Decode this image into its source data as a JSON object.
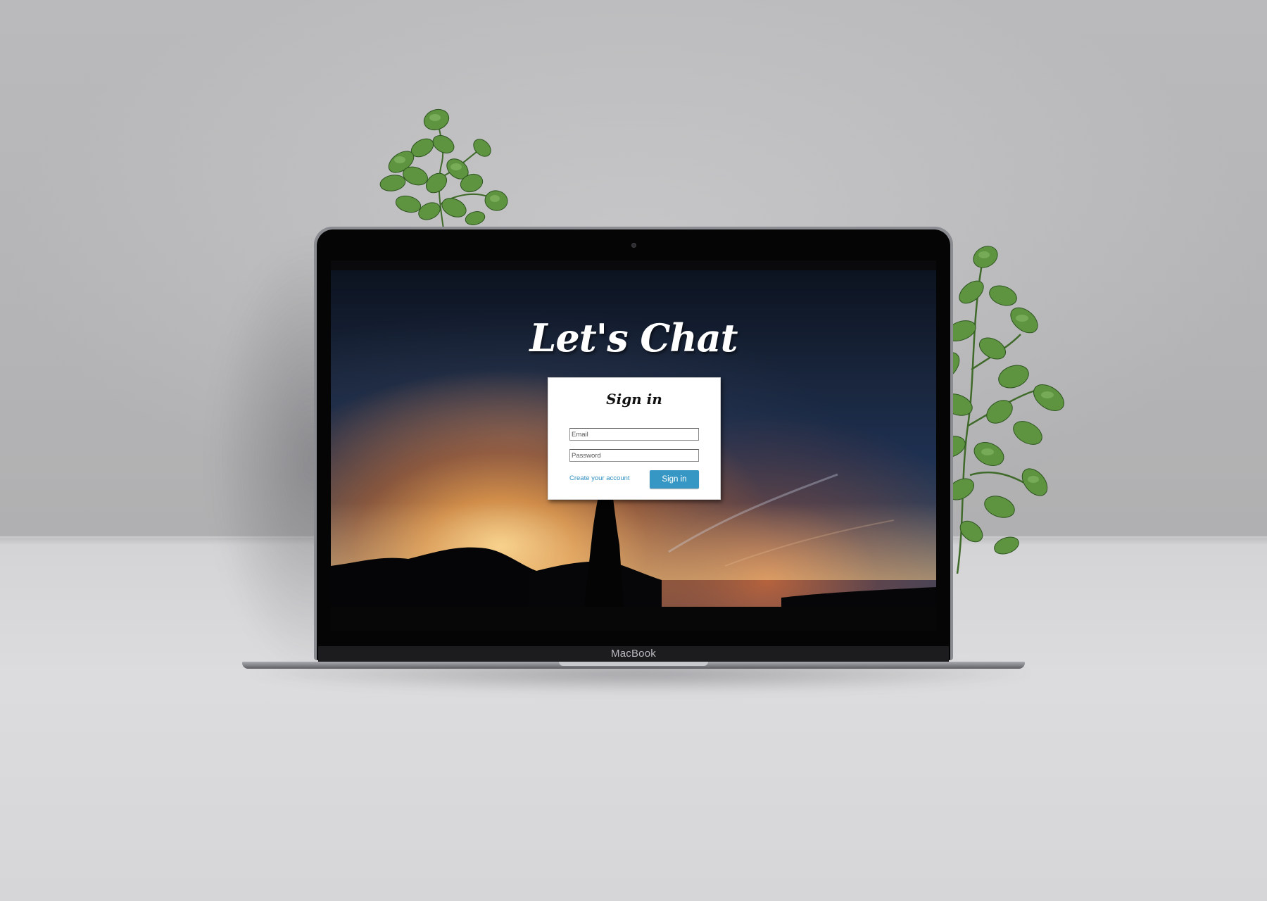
{
  "device": {
    "brand_label": "MacBook"
  },
  "app": {
    "title": "Let's Chat"
  },
  "signin_card": {
    "heading": "Sign in",
    "email_placeholder": "Email",
    "password_placeholder": "Password",
    "create_account_link": "Create your account",
    "submit_label": "Sign in"
  },
  "icons": {
    "camera": "webcam-icon",
    "plant_left": "plant-icon",
    "plant_right": "plant-icon"
  },
  "colors": {
    "accent": "#3697c5",
    "link": "#2f8fc0",
    "background": "#c0c0c2"
  }
}
